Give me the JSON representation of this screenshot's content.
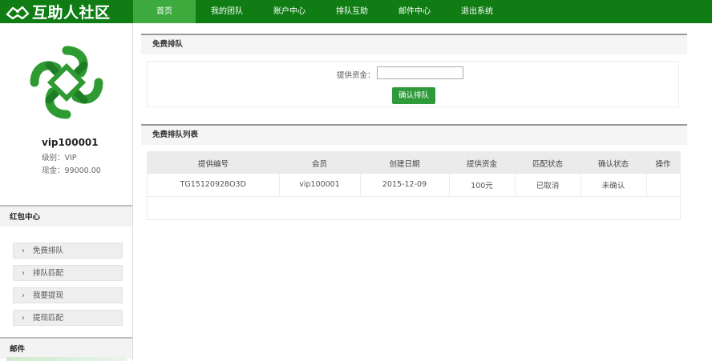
{
  "brand": {
    "name": "互助人社区"
  },
  "nav": [
    {
      "label": "首页",
      "active": true
    },
    {
      "label": "我的团队",
      "active": false
    },
    {
      "label": "账户中心",
      "active": false
    },
    {
      "label": "排队互助",
      "active": false
    },
    {
      "label": "邮件中心",
      "active": false
    },
    {
      "label": "退出系统",
      "active": false
    }
  ],
  "profile": {
    "username": "vip100001",
    "level_line": "级别：VIP",
    "cash_line": "现金：99000.00"
  },
  "sidebar": {
    "section_title": "红包中心",
    "items": [
      {
        "label": "免费排队"
      },
      {
        "label": "排队匹配"
      },
      {
        "label": "我要提现"
      },
      {
        "label": "提现匹配"
      }
    ],
    "mail_section_title": "邮件"
  },
  "queue_form": {
    "title": "免费排队",
    "amount_label": "提供资金：",
    "amount_value": "",
    "confirm_label": "确认排队"
  },
  "queue_list": {
    "title": "免费排队列表",
    "columns": [
      "提供编号",
      "会员",
      "创建日期",
      "提供资金",
      "匹配状态",
      "确认状态",
      "操作"
    ],
    "rows": [
      [
        "TG15120928O3D",
        "vip100001",
        "2015-12-09",
        "100元",
        "已取消",
        "未确认",
        ""
      ]
    ]
  },
  "colors": {
    "nav_bg": "#0f7d14",
    "nav_active": "#3daa3d",
    "button_green": "#2f9a3a"
  }
}
